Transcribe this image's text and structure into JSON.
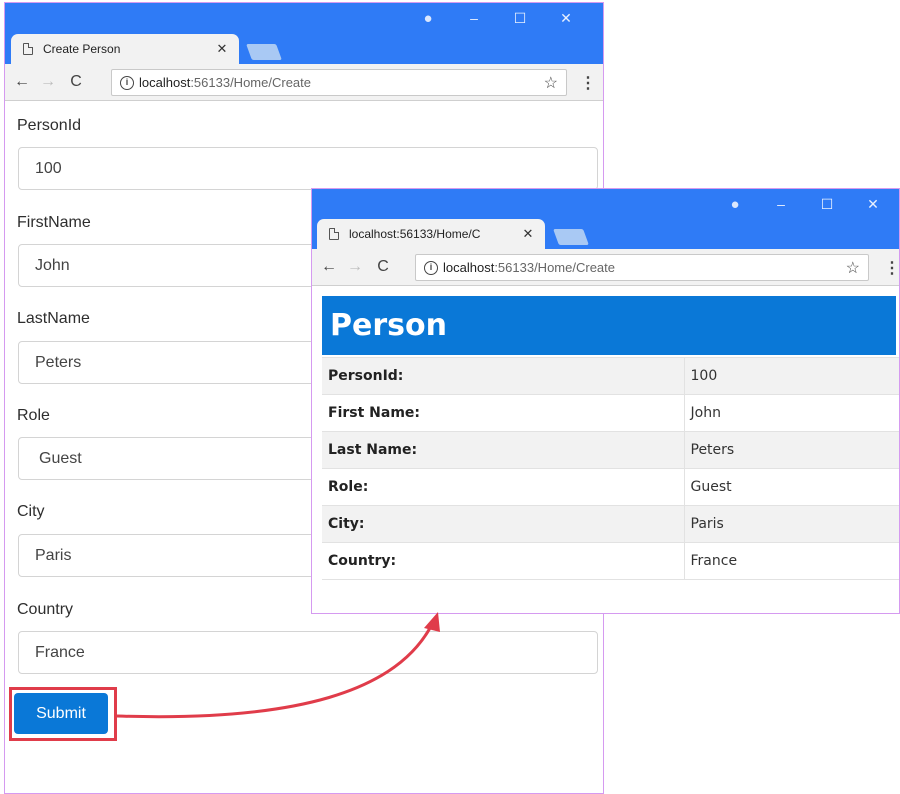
{
  "colors": {
    "titlebar": "#2f7bf6",
    "accent": "#0a78d7",
    "highlight": "#e03c4a"
  },
  "form_window": {
    "tab_title": "Create Person",
    "url_host": "localhost",
    "url_path": ":56133/Home/Create",
    "fields": [
      {
        "label": "PersonId",
        "value": "100"
      },
      {
        "label": "FirstName",
        "value": "John"
      },
      {
        "label": "LastName",
        "value": "Peters"
      },
      {
        "label": "Role",
        "value": "Guest"
      },
      {
        "label": "City",
        "value": "Paris"
      },
      {
        "label": "Country",
        "value": "France"
      }
    ],
    "submit_label": "Submit"
  },
  "result_window": {
    "tab_title": "localhost:56133/Home/C",
    "url_host": "localhost",
    "url_path": ":56133/Home/Create",
    "heading": "Person",
    "rows": [
      {
        "key": "PersonId:",
        "value": "100"
      },
      {
        "key": "First Name:",
        "value": "John"
      },
      {
        "key": "Last Name:",
        "value": "Peters"
      },
      {
        "key": "Role:",
        "value": "Guest"
      },
      {
        "key": "City:",
        "value": "Paris"
      },
      {
        "key": "Country:",
        "value": "France"
      }
    ]
  },
  "icons": {
    "back": "arrow-left-icon",
    "forward": "arrow-right-icon",
    "reload": "reload-icon",
    "info": "info-icon",
    "star": "star-icon",
    "menu": "kebab-menu-icon",
    "account": "account-icon",
    "minimize": "minimize-icon",
    "maximize": "maximize-icon",
    "close": "close-icon"
  }
}
